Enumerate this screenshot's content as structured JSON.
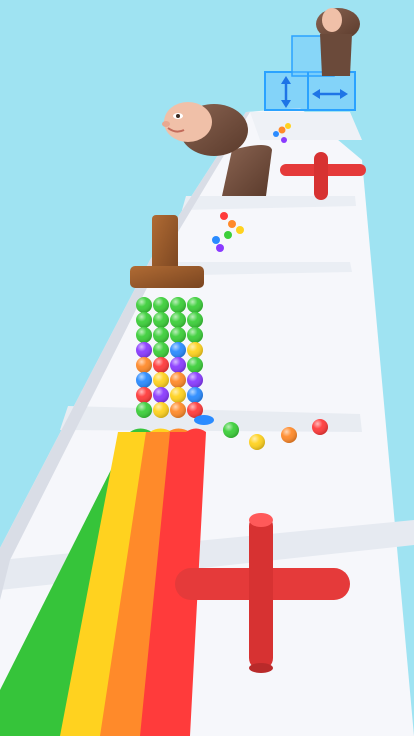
{
  "scene": {
    "title": "",
    "colors": {
      "sky": "#9fe3f2",
      "track": "#f6f7fb",
      "track_shadow": "#e6eaf1",
      "track_edge": "#d9dde6",
      "cross": "#e53a3a",
      "cross_dark": "#b92a2a",
      "brush_wood": "#9a5a2b",
      "brush_wood_dark": "#7a4520",
      "hair": "#6b4a3a",
      "skin": "#f0c0a8",
      "glass": "#6bc6ff",
      "glass_frame": "#2aa2ff"
    },
    "rainbow_stripes": [
      "#36c43a",
      "#ffd21f",
      "#ff8a2a",
      "#ff3b3b"
    ],
    "ball_colors": [
      "#3ccf3a",
      "#ffd21f",
      "#ff8a2a",
      "#ff3b3b",
      "#8a3bff",
      "#2a8bff"
    ],
    "icons": [
      "vertical-arrows-icon",
      "horizontal-arrows-icon"
    ]
  }
}
